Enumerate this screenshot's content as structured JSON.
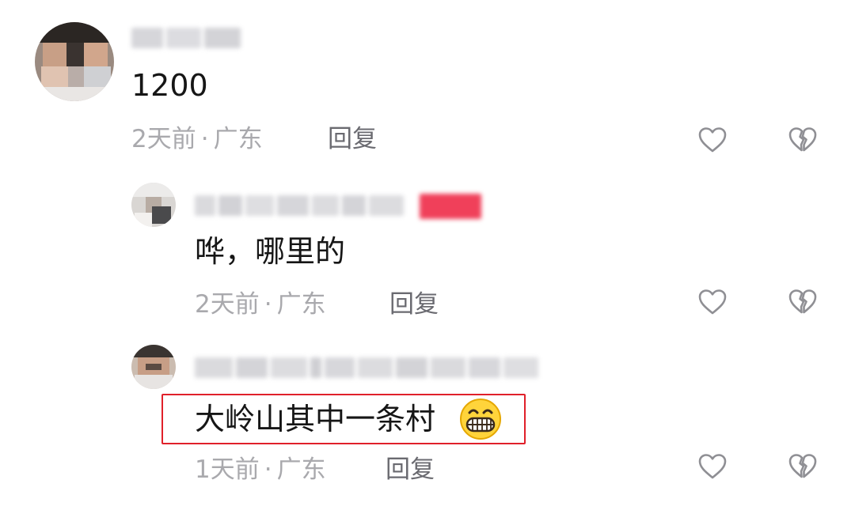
{
  "comments": [
    {
      "text": "1200",
      "time": "2天前",
      "separator": "·",
      "location": "广东",
      "reply_label": "回复"
    },
    {
      "text": "哗，哪里的",
      "time": "2天前",
      "separator": "·",
      "location": "广东",
      "reply_label": "回复"
    },
    {
      "text": "大岭山其中一条村",
      "time": "1天前",
      "separator": "·",
      "location": "广东",
      "reply_label": "回复"
    }
  ],
  "icons": {
    "like": "heart-outline-icon",
    "dislike": "broken-heart-icon",
    "emoji": "grinning-face-emoji"
  },
  "colors": {
    "highlight": "#e0202a",
    "meta_text": "#a9a9ad",
    "reply_text": "#6a6a70",
    "badge": "#f0405a"
  }
}
